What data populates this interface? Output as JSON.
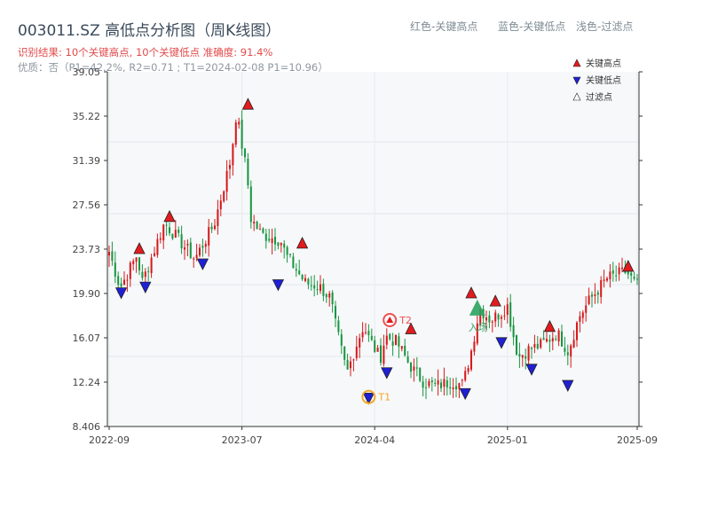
{
  "header": {
    "title": "003011.SZ 高低点分析图（周K线图）",
    "legend_high": "红色-关键高点",
    "legend_low": "蓝色-关键低点",
    "legend_filter": "浅色-过滤点",
    "result_line": "识别结果: 10个关键高点, 10个关键低点  准确度: 91.4%",
    "quality_line": "优质：否（P1=42.2%, R2=0.71 ; T1=2024-02-08 P1=10.96）"
  },
  "colors": {
    "up": "#d7191c",
    "down": "#1a9641",
    "high_marker": "#e41a1c",
    "low_marker": "#1f1fd6",
    "t1": "#f5a623",
    "t2": "#f05050",
    "entry": "#2ca25f",
    "plot_bg": "#f6f8fa"
  },
  "chart_data": {
    "type": "candlestick",
    "y_ticks": [
      "8.406",
      "12.24",
      "16.07",
      "19.90",
      "23.73",
      "27.56",
      "31.39",
      "35.22",
      "39.05"
    ],
    "ylim": [
      8.406,
      39.05
    ],
    "x_ticks": [
      {
        "label": "2022-09",
        "idx": 0
      },
      {
        "label": "2023-07",
        "idx": 44
      },
      {
        "label": "2024-04",
        "idx": 88
      },
      {
        "label": "2025-01",
        "idx": 132
      },
      {
        "label": "2025-09",
        "idx": 175
      }
    ],
    "n_points": 176,
    "anchors": [
      [
        0,
        23.5
      ],
      [
        4,
        20.4
      ],
      [
        10,
        23.2
      ],
      [
        12,
        20.9
      ],
      [
        20,
        26.0
      ],
      [
        31,
        22.9
      ],
      [
        38,
        25.9
      ],
      [
        44,
        31.5
      ],
      [
        46,
        35.5
      ],
      [
        50,
        30.0
      ],
      [
        51,
        26.5
      ],
      [
        55,
        25.0
      ],
      [
        62,
        24.5
      ],
      [
        64,
        23.2
      ],
      [
        71,
        20.8
      ],
      [
        76,
        20.5
      ],
      [
        80,
        19.5
      ],
      [
        82,
        17.0
      ],
      [
        86,
        13.0
      ],
      [
        89,
        15.2
      ],
      [
        92,
        17.1
      ],
      [
        94,
        16.0
      ],
      [
        98,
        14.3
      ],
      [
        100,
        16.2
      ],
      [
        104,
        15.7
      ],
      [
        108,
        14.0
      ],
      [
        110,
        13.3
      ],
      [
        114,
        12.2
      ],
      [
        118,
        11.9
      ],
      [
        124,
        12.3
      ],
      [
        128,
        12.0
      ],
      [
        131,
        15.0
      ],
      [
        134,
        18.6
      ],
      [
        138,
        17.6
      ],
      [
        142,
        18.3
      ],
      [
        144,
        18.9
      ],
      [
        146,
        16.5
      ],
      [
        148,
        14.4
      ],
      [
        152,
        15.1
      ],
      [
        156,
        15.4
      ],
      [
        162,
        16.5
      ],
      [
        166,
        14.9
      ],
      [
        170,
        17.9
      ],
      [
        174,
        19.4
      ],
      [
        180,
        21.2
      ],
      [
        187,
        21.8
      ],
      [
        190,
        20.8
      ],
      [
        191,
        20.6
      ]
    ],
    "key_highs": [
      {
        "idx": 10,
        "price": 23.73
      },
      {
        "idx": 20,
        "price": 26.5
      },
      {
        "idx": 46,
        "price": 36.2
      },
      {
        "idx": 64,
        "price": 24.2
      },
      {
        "idx": 100,
        "price": 16.8
      },
      {
        "idx": 120,
        "price": 19.9
      },
      {
        "idx": 128,
        "price": 19.2
      },
      {
        "idx": 146,
        "price": 17.0
      },
      {
        "idx": 172,
        "price": 22.2
      }
    ],
    "key_lows": [
      {
        "idx": 4,
        "price": 20.0
      },
      {
        "idx": 12,
        "price": 20.5
      },
      {
        "idx": 31,
        "price": 22.5
      },
      {
        "idx": 56,
        "price": 20.7
      },
      {
        "idx": 86,
        "price": 10.9
      },
      {
        "idx": 92,
        "price": 13.1
      },
      {
        "idx": 118,
        "price": 11.3
      },
      {
        "idx": 130,
        "price": 15.7
      },
      {
        "idx": 140,
        "price": 13.4
      },
      {
        "idx": 152,
        "price": 12.0
      }
    ],
    "t1": {
      "label": "T1",
      "idx": 86,
      "price": 10.96
    },
    "t2": {
      "label": "T2",
      "idx": 93,
      "price": 17.6
    },
    "entry": {
      "label": "入场",
      "idx": 122,
      "price": 18.6
    },
    "plot_legend": [
      "关键高点",
      "关键低点",
      "过滤点"
    ]
  }
}
